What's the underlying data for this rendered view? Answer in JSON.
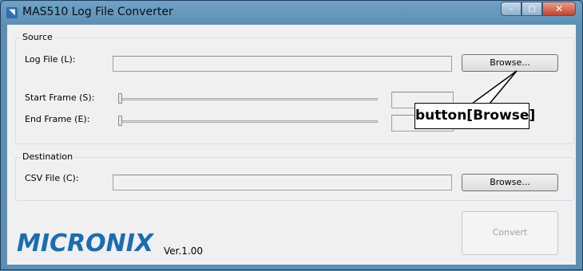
{
  "window": {
    "title": "MAS510 Log File Converter",
    "caption_minimize": "–",
    "caption_maximize": "□",
    "caption_close": "✕"
  },
  "source": {
    "group_title": "Source",
    "log_file_label": "Log File (L):",
    "log_file_value": "",
    "browse_label": "Browse...",
    "start_frame_label": "Start Frame (S):",
    "start_frame_value": "",
    "end_frame_label": "End Frame (E):",
    "end_frame_value": ""
  },
  "destination": {
    "group_title": "Destination",
    "csv_file_label": "CSV File (C):",
    "csv_file_value": "",
    "browse_label": "Browse..."
  },
  "actions": {
    "convert_label": "Convert",
    "convert_enabled": false
  },
  "branding": {
    "logo_text": "MICRONIX",
    "version": "Ver.1.00"
  },
  "annotation": {
    "callout_text": "button[Browse]"
  },
  "colors": {
    "logo": "#1b6cb2",
    "title_bar": "#6fa2c6",
    "close_button": "#c5432a"
  }
}
